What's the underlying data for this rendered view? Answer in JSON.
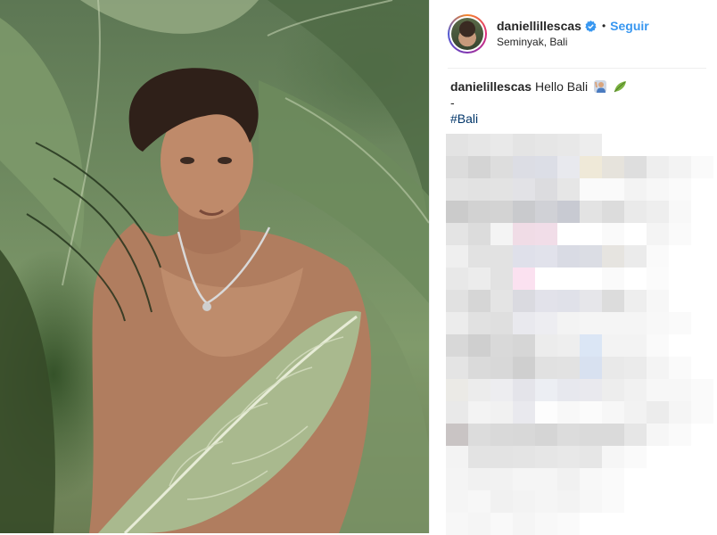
{
  "post": {
    "username": "daniellillescas",
    "follow_label": "Seguir",
    "location": "Seminyak, Bali",
    "separator": "•"
  },
  "caption": {
    "username": "danielillescas",
    "text": "Hello Bali",
    "dash": "-",
    "hashtag": "#Bali"
  },
  "icons": {
    "verified": "verified-badge-icon",
    "emoji1": "person-raising-hand-emoji",
    "emoji2": "leaf-emoji"
  },
  "colors": {
    "link_blue": "#3897f0",
    "hashtag": "#003569",
    "text": "#262626",
    "border": "#efefef"
  },
  "blurred_comments": [
    [
      "#e3e3e3",
      "#e6e6e6",
      "#e9e9e9",
      "#e4e4e4",
      "#e6e6e6",
      "#e8e8e8",
      "#ededed",
      "#ffffff",
      "#ffffff",
      "#ffffff",
      "#ffffff",
      "#ffffff"
    ],
    [
      "#dcdcdc",
      "#d4d4d4",
      "#dddddd",
      "#dcdde4",
      "#dcdee6",
      "#e8e9ee",
      "#efe9d8",
      "#e6e3dc",
      "#dedede",
      "#eeeeee",
      "#f3f3f3",
      "#fafafa"
    ],
    [
      "#e4e4e4",
      "#e2e2e2",
      "#e3e3e3",
      "#e2e2e6",
      "#dcdcdf",
      "#e6e6e6",
      "#fafafa",
      "#fafafa",
      "#f3f3f3",
      "#f7f7f7",
      "#fafafa",
      "#ffffff"
    ],
    [
      "#cbcbcb",
      "#d2d2d2",
      "#d3d3d3",
      "#c9cacd",
      "#d0d1d6",
      "#c8cad2",
      "#e3e3e3",
      "#dcdcdc",
      "#eaeaea",
      "#eeeeee",
      "#f8f8f8",
      "#ffffff"
    ],
    [
      "#e4e4e4",
      "#dcdcdc",
      "#f4f4f4",
      "#f0dce6",
      "#f1dde8",
      "#ffffff",
      "#ffffff",
      "#fafafa",
      "#ffffff",
      "#f4f4f4",
      "#fafafa",
      "#ffffff"
    ],
    [
      "#efefef",
      "#e2e2e2",
      "#e2e2e2",
      "#dfe0ea",
      "#e1e2eb",
      "#d9dbe4",
      "#dbdde4",
      "#e6e4e0",
      "#ebebeb",
      "#fafafa",
      "#ffffff",
      "#ffffff"
    ],
    [
      "#e8e8e8",
      "#ececec",
      "#e2e2e2",
      "#fbe1f0",
      "#ffffff",
      "#ffffff",
      "#ffffff",
      "#fafafa",
      "#ffffff",
      "#fbfbfb",
      "#ffffff",
      "#ffffff"
    ],
    [
      "#e1e1e1",
      "#d6d6d6",
      "#e4e4e4",
      "#dadae0",
      "#e2e2ea",
      "#e0e1e9",
      "#e6e6ea",
      "#dcdcdc",
      "#eeeeee",
      "#f7f7f7",
      "#ffffff",
      "#ffffff"
    ],
    [
      "#ececec",
      "#e1e1e1",
      "#dfdfdf",
      "#e9e9ee",
      "#ededf1",
      "#f3f3f3",
      "#f5f5f5",
      "#f5f5f5",
      "#f5f5f5",
      "#f8f8f8",
      "#fafafa",
      "#ffffff"
    ],
    [
      "#d8d8d8",
      "#cfcfcf",
      "#d9d9d9",
      "#d6d6d6",
      "#ececec",
      "#eeeeee",
      "#dbe6f5",
      "#f3f3f3",
      "#f3f3f3",
      "#fafafa",
      "#ffffff",
      "#ffffff"
    ],
    [
      "#e4e4e4",
      "#dadada",
      "#d8d8d8",
      "#cfcfcf",
      "#e1e1e1",
      "#e2e2e2",
      "#d8e1f0",
      "#e9e9e9",
      "#ebebeb",
      "#f4f4f4",
      "#fafafa",
      "#ffffff"
    ],
    [
      "#ebeae6",
      "#ececec",
      "#ededf0",
      "#e4e4ea",
      "#eceef3",
      "#e7e8ee",
      "#e9e9ee",
      "#ededed",
      "#f1f1f1",
      "#f7f7f7",
      "#f7f7f7",
      "#fafafa"
    ],
    [
      "#e9e9e9",
      "#f3f3f3",
      "#f1f1f1",
      "#e9e9ee",
      "#fdfdfd",
      "#f8f8f8",
      "#fbfbfb",
      "#f7f7f7",
      "#f2f2f2",
      "#ececec",
      "#f5f5f5",
      "#fafafa"
    ],
    [
      "#c9c4c4",
      "#dcdcdc",
      "#d9d9d9",
      "#d8d8d8",
      "#d5d5d5",
      "#dcdcdc",
      "#dadada",
      "#dadada",
      "#e6e6e6",
      "#f6f6f6",
      "#fafafa",
      "#ffffff"
    ],
    [
      "#f3f3f3",
      "#e3e3e3",
      "#e3e3e3",
      "#e4e4e4",
      "#e6e6e6",
      "#e8e8e8",
      "#e6e6e6",
      "#f6f6f6",
      "#fafafa",
      "#ffffff",
      "#ffffff",
      "#ffffff"
    ],
    [
      "#f4f4f4",
      "#f1f1f1",
      "#f2f2f2",
      "#f5f5f5",
      "#f5f5f5",
      "#f1f1f1",
      "#f8f8f8",
      "#fafafa",
      "#ffffff",
      "#ffffff",
      "#ffffff",
      "#ffffff"
    ],
    [
      "#f5f5f5",
      "#f7f7f7",
      "#f1f1f1",
      "#f3f3f3",
      "#f5f5f5",
      "#f3f3f3",
      "#f7f7f7",
      "#fafafa",
      "#ffffff",
      "#ffffff",
      "#ffffff",
      "#ffffff"
    ],
    [
      "#f7f7f7",
      "#f5f5f5",
      "#f9f9f9",
      "#f5f5f5",
      "#f8f8f8",
      "#fafafa",
      "#ffffff",
      "#ffffff",
      "#ffffff",
      "#ffffff",
      "#ffffff",
      "#ffffff"
    ]
  ]
}
